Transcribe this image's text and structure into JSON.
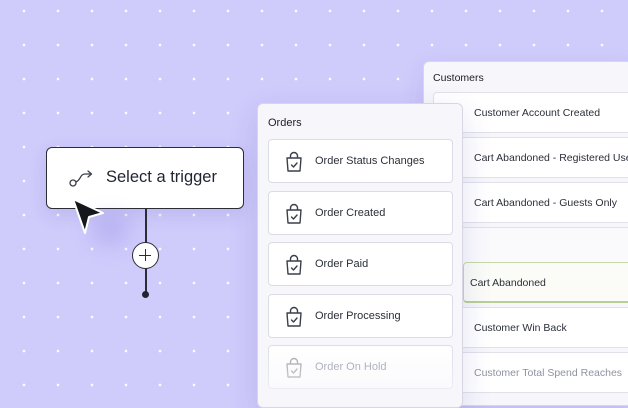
{
  "trigger": {
    "label": "Select a trigger",
    "icon": "route-icon"
  },
  "orders": {
    "title": "Orders",
    "items": [
      {
        "label": "Order Status Changes",
        "icon": "shopping-bag-check-icon"
      },
      {
        "label": "Order Created",
        "icon": "shopping-bag-check-icon"
      },
      {
        "label": "Order Paid",
        "icon": "shopping-bag-check-icon"
      },
      {
        "label": "Order Processing",
        "icon": "shopping-bag-check-icon"
      },
      {
        "label": "Order On Hold",
        "icon": "shopping-bag-check-icon"
      }
    ]
  },
  "customers": {
    "title": "Customers",
    "items": [
      {
        "label": "Customer Account Created"
      },
      {
        "label": "Cart Abandoned - Registered Use.."
      },
      {
        "label": "Cart Abandoned - Guests Only"
      },
      {
        "label": ""
      },
      {
        "label": "Cart Abandoned",
        "selected": true
      },
      {
        "label": "Customer Win Back"
      },
      {
        "label": "Customer Total Spend Reaches"
      }
    ]
  },
  "colors": {
    "background": "#cfcbfb",
    "selected_check": "#8cc08e"
  }
}
